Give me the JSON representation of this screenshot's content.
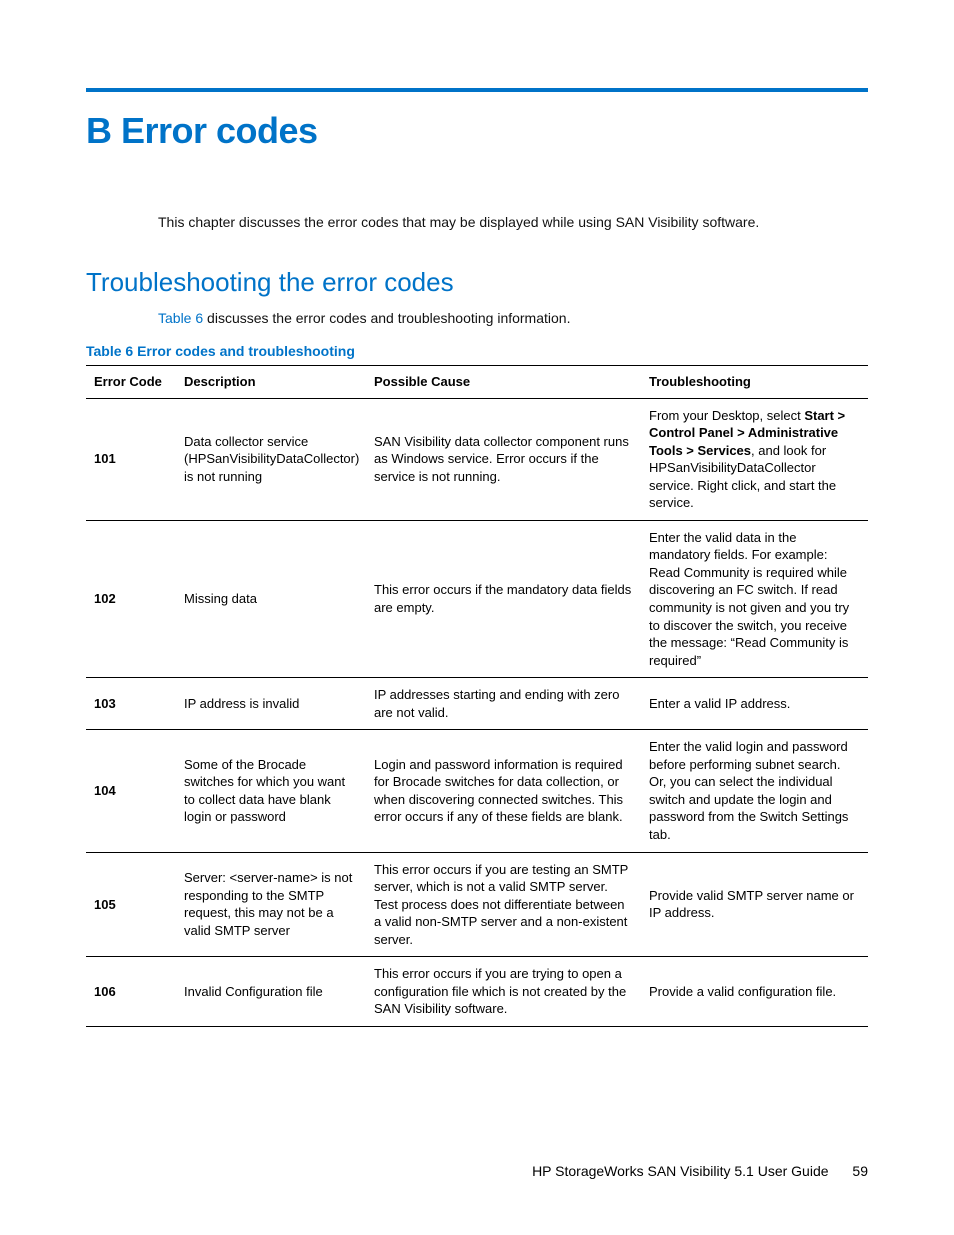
{
  "appendix_title": "B Error codes",
  "intro_text": "This chapter discusses the error codes that may be displayed while using SAN Visibility software.",
  "section_title": "Troubleshooting the error codes",
  "section_intro_xref": "Table 6",
  "section_intro_rest": " discusses the error codes and troubleshooting information.",
  "table_caption": "Table 6 Error codes and troubleshooting",
  "headers": {
    "code": "Error Code",
    "desc": "Description",
    "cause": "Possible Cause",
    "trbl": "Troubleshooting"
  },
  "rows": [
    {
      "code": "101",
      "desc": "Data collector service (HPSanVisibilityDataCollector) is not running",
      "cause": "SAN Visibility data collector component runs as Windows service. Error occurs if the service is not running.",
      "trbl": {
        "pre": "From your Desktop, select ",
        "bold": "Start > Control Panel > Administrative Tools > Services",
        "post": ", and look for HPSanVisibilityDataCollector service. Right click, and start the service."
      }
    },
    {
      "code": "102",
      "desc": "Missing data",
      "cause": "This error occurs if the mandatory data fields are empty.",
      "trbl": {
        "pre": "Enter the valid data in the mandatory fields. For example: Read Community is required while discovering an FC switch. If read community is not given and you try to discover the switch, you receive the message: “Read Community is required”",
        "bold": "",
        "post": ""
      }
    },
    {
      "code": "103",
      "desc": "IP address is invalid",
      "cause": "IP addresses starting and ending with zero are not valid.",
      "trbl": {
        "pre": "Enter a valid IP address.",
        "bold": "",
        "post": ""
      }
    },
    {
      "code": "104",
      "desc": "Some of the Brocade switches for which you want to collect data have blank login or password",
      "cause": "Login and password information is required for Brocade switches for data collection, or when discovering connected switches. This error occurs if any of these fields are blank.",
      "trbl": {
        "pre": "Enter the valid login and password before performing subnet search. Or, you can select the individual switch and update the login and password from the Switch Settings tab.",
        "bold": "",
        "post": ""
      }
    },
    {
      "code": "105",
      "desc": "Server: <server-name> is not responding to the SMTP request, this may not be a valid SMTP server",
      "cause": "This error occurs if you are testing an SMTP server, which is not a valid SMTP server. Test process does not differentiate between a valid non-SMTP server and a non-existent server.",
      "trbl": {
        "pre": "Provide valid SMTP server name or IP address.",
        "bold": "",
        "post": ""
      }
    },
    {
      "code": "106",
      "desc": "Invalid Configuration file",
      "cause": "This error occurs if you are trying to open a configuration file which is not created by the SAN Visibility software.",
      "trbl": {
        "pre": "Provide a valid configuration file.",
        "bold": "",
        "post": ""
      }
    }
  ],
  "footer": {
    "doc": "HP StorageWorks SAN Visibility 5.1 User Guide",
    "page": "59"
  }
}
